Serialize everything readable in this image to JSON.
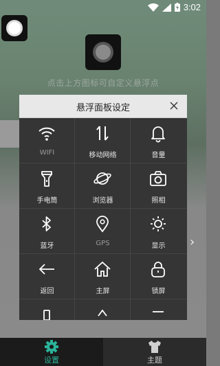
{
  "status_bar": {
    "time": "3:02"
  },
  "main": {
    "hint": "点击上方图标可自定义悬浮点"
  },
  "dialog": {
    "title": "悬浮面板设定",
    "items": [
      {
        "label": "WIFI",
        "icon": "wifi-icon",
        "dim": true
      },
      {
        "label": "移动网络",
        "icon": "mobile-data-icon"
      },
      {
        "label": "音量",
        "icon": "bell-icon"
      },
      {
        "label": "手电筒",
        "icon": "flashlight-icon"
      },
      {
        "label": "浏览器",
        "icon": "planet-browser-icon"
      },
      {
        "label": "照相",
        "icon": "camera-icon"
      },
      {
        "label": "蓝牙",
        "icon": "bluetooth-icon"
      },
      {
        "label": "GPS",
        "icon": "location-pin-icon",
        "dim": true
      },
      {
        "label": "显示",
        "icon": "brightness-icon"
      },
      {
        "label": "返回",
        "icon": "back-arrow-icon"
      },
      {
        "label": "主屏",
        "icon": "home-icon"
      },
      {
        "label": "锁屏",
        "icon": "lock-icon"
      }
    ]
  },
  "tabs": [
    {
      "label": "设置",
      "icon": "gear-icon",
      "active": true,
      "color": "#2bb39a"
    },
    {
      "label": "主题",
      "icon": "tshirt-icon",
      "active": false
    }
  ]
}
